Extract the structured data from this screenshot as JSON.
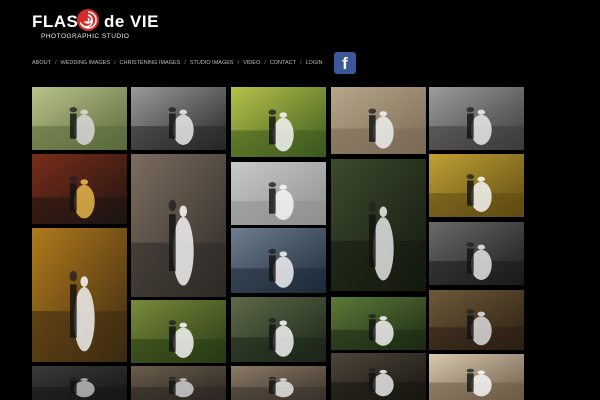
{
  "brand": {
    "left_word": "FLASH",
    "right_word": "de VIE",
    "tagline": "PHOTOGRAPHIC STUDIO",
    "logo_color": "#d42a2a"
  },
  "nav": {
    "items": [
      "ABOUT",
      "WEDDING IMAGES",
      "CHRISTENING IMAGES",
      "STUDIO IMAGES",
      "VIDEO",
      "CONTACT",
      "LOGIN"
    ],
    "separator": "/"
  },
  "social": {
    "facebook_glyph": "f",
    "facebook_icon": "facebook-icon",
    "facebook_color": "#3b5998"
  },
  "gallery": {
    "photos": [
      {
        "name": "car-couple-photo",
        "colors": [
          "#5a6a3a",
          "#b9c28a",
          "#d7d7d7"
        ]
      },
      {
        "name": "couple-embrace-bw-photo",
        "colors": [
          "#262626",
          "#9a9a9a",
          "#e7e7e7"
        ]
      },
      {
        "name": "couple-garden-photo",
        "colors": [
          "#3c5a1e",
          "#b7c24a",
          "#f3f3f3"
        ]
      },
      {
        "name": "couple-field-photo",
        "colors": [
          "#7a6a55",
          "#b6a78a",
          "#eeeeee"
        ]
      },
      {
        "name": "couple-ruins-bw-photo",
        "colors": [
          "#3a3a3a",
          "#9c9c9c",
          "#e9e9e9"
        ]
      },
      {
        "name": "carousel-night-photo",
        "colors": [
          "#1e1411",
          "#7a2d1a",
          "#e7b54a"
        ]
      },
      {
        "name": "stone-arch-photo",
        "colors": [
          "#2e2a26",
          "#7c6d5f",
          "#f2f2f2"
        ]
      },
      {
        "name": "dining-hall-photo",
        "colors": [
          "#8f8f8f",
          "#c9c9c9",
          "#f5f5f5"
        ]
      },
      {
        "name": "forest-snow-photo",
        "colors": [
          "#14190f",
          "#3b4a2d",
          "#e4e4e4"
        ]
      },
      {
        "name": "autumn-kiss-photo",
        "colors": [
          "#5e4a12",
          "#c0a034",
          "#f5f5f5"
        ]
      },
      {
        "name": "autumn-couple-photo",
        "colors": [
          "#3d2a10",
          "#b07a1c",
          "#f0f0f0"
        ]
      },
      {
        "name": "lake-couple-photo",
        "colors": [
          "#1e2a3a",
          "#6d7e8e",
          "#f0f0f0"
        ]
      },
      {
        "name": "hallway-bw-photo",
        "colors": [
          "#1a1a1a",
          "#6a6a6a",
          "#e4e4e4"
        ]
      },
      {
        "name": "couple-meadow-photo",
        "colors": [
          "#263a14",
          "#7a8a3a",
          "#f4f4f4"
        ]
      },
      {
        "name": "waterfall-couple-photo",
        "colors": [
          "#1b2417",
          "#5d6a4a",
          "#f2f2f2"
        ]
      },
      {
        "name": "forest-fence-photo",
        "colors": [
          "#1c2a14",
          "#5c7a38",
          "#f0f0f0"
        ]
      },
      {
        "name": "wooden-bench-photo",
        "colors": [
          "#2a1e12",
          "#6e5a3a",
          "#dcdcdc"
        ]
      },
      {
        "name": "dark-doorway-photo",
        "colors": [
          "#151515",
          "#3a3a3a",
          "#bcbcbc"
        ]
      },
      {
        "name": "stone-wall-photo",
        "colors": [
          "#2b2620",
          "#6a5d4c",
          "#cfcfcf"
        ]
      },
      {
        "name": "ruins-interior-photo",
        "colors": [
          "#3a332b",
          "#8b7a66",
          "#e5e5e5"
        ]
      },
      {
        "name": "arched-tunnel-photo",
        "colors": [
          "#171510",
          "#4d4538",
          "#e8e8e8"
        ]
      },
      {
        "name": "bride-closeup-photo",
        "colors": [
          "#6d5a45",
          "#d8c9b0",
          "#f6f6f6"
        ]
      }
    ]
  }
}
